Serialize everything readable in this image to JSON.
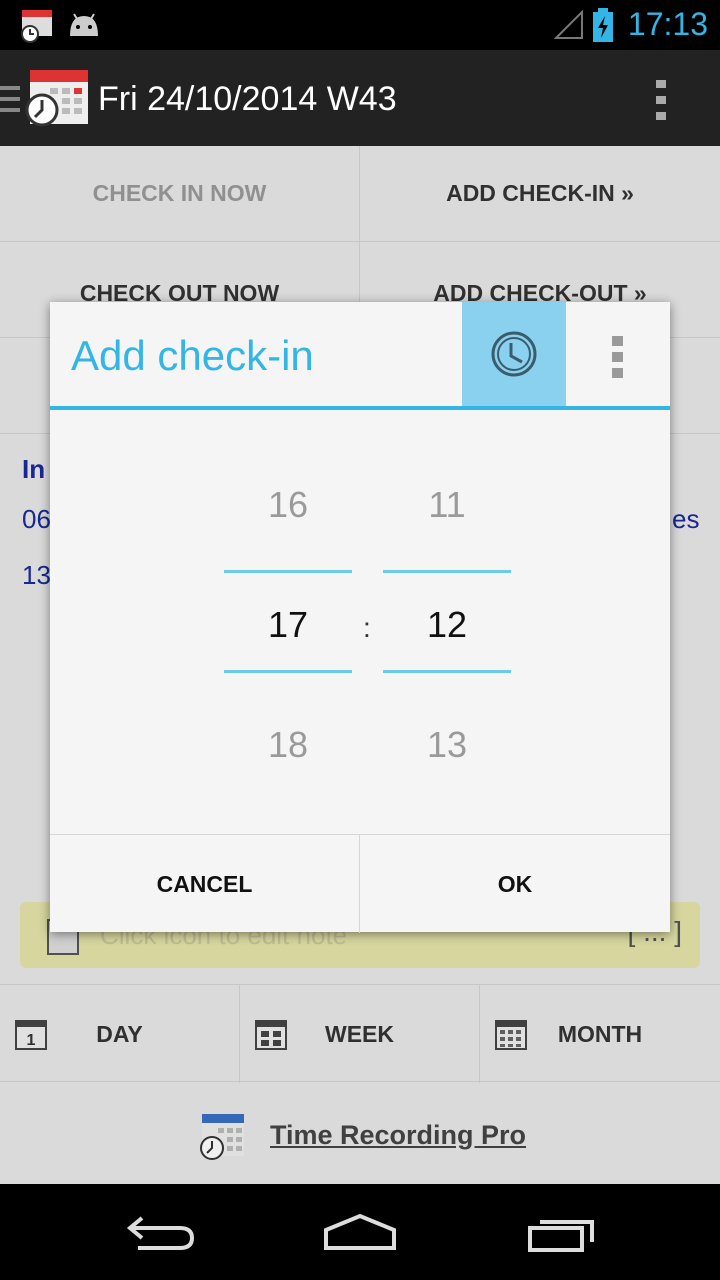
{
  "status_bar": {
    "time": "17:13",
    "icons": [
      "calendar-clock-icon",
      "android-icon",
      "signal-icon",
      "battery-charging-icon"
    ]
  },
  "action_bar": {
    "title": "Fri 24/10/2014 W43"
  },
  "actions": {
    "check_in_now": "CHECK IN NOW",
    "add_check_in": "ADD CHECK-IN »",
    "check_out_now": "CHECK OUT NOW",
    "add_check_out": "ADD CHECK-OUT »"
  },
  "background_fragments": {
    "in_label": "In",
    "row1_start": "06",
    "row1_end": "es",
    "row2_start": "13"
  },
  "note": {
    "placeholder": "Click icon to edit note",
    "ellipsis": "[ ... ]"
  },
  "tabs": {
    "day": "DAY",
    "week": "WEEK",
    "month": "MONTH"
  },
  "promo": {
    "label": "Time Recording Pro"
  },
  "dialog": {
    "title": "Add check-in",
    "hours": {
      "prev": "16",
      "selected": "17",
      "next": "18"
    },
    "minutes": {
      "prev": "11",
      "selected": "12",
      "next": "13"
    },
    "separator": ":",
    "cancel": "CANCEL",
    "ok": "OK"
  },
  "colors": {
    "accent": "#33b5e5",
    "clock_button_bg": "#8ad1ef",
    "action_bar_bg": "#222222",
    "note_bg": "#e4e4a8"
  }
}
